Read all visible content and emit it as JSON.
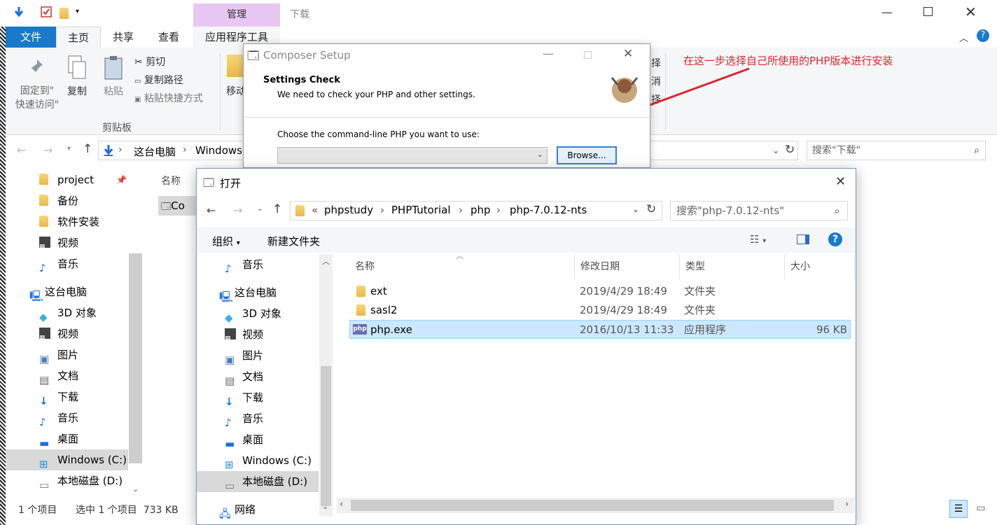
{
  "explorer": {
    "title_context": "管理",
    "title": "下载",
    "tabs": [
      "文件",
      "主页",
      "共享",
      "查看",
      "应用程序工具"
    ],
    "ribbon": {
      "pin_label": "固定到\"\n快速访问\"",
      "copy_label": "复制",
      "paste_label": "粘贴",
      "cut_label": "剪切",
      "copy_path_label": "复制路径",
      "paste_shortcut_label": "粘贴快捷方式",
      "move_label": "移动",
      "group_clipboard": "剪贴板",
      "partial_right": [
        "择",
        "消",
        "择"
      ]
    },
    "address": {
      "parts": [
        "这台电脑",
        "Windows"
      ]
    },
    "search_placeholder": "搜索\"下载\"",
    "nav": [
      "project",
      "备份",
      "软件安装",
      "视频",
      "音乐",
      "这台电脑",
      "3D 对象",
      "视频",
      "图片",
      "文档",
      "下载",
      "音乐",
      "桌面",
      "Windows (C:)",
      "本地磁盘 (D:)"
    ],
    "col_name": "名称",
    "file_partial": "Co",
    "status_count": "1 个项目",
    "status_selected": "选中 1 个项目  733 KB"
  },
  "annotation": "在这一步选择自己所使用的PHP版本进行安装",
  "composer": {
    "title": "Composer Setup",
    "heading": "Settings Check",
    "subheading": "We need to check your PHP and other settings.",
    "choose_label": "Choose the command-line PHP you want to use:",
    "combo_value": "",
    "browse_label": "Browse..."
  },
  "open_dialog": {
    "title": "打开",
    "path": [
      "«",
      "phpstudy",
      "PHPTutorial",
      "php",
      "php-7.0.12-nts"
    ],
    "search_placeholder": "搜索\"php-7.0.12-nts\"",
    "organize_label": "组织",
    "new_folder_label": "新建文件夹",
    "nav": [
      "音乐",
      "这台电脑",
      "3D 对象",
      "视频",
      "图片",
      "文档",
      "下载",
      "音乐",
      "桌面",
      "Windows (C:)",
      "本地磁盘 (D:)",
      "网络"
    ],
    "columns": [
      "名称",
      "修改日期",
      "类型",
      "大小"
    ],
    "files": [
      {
        "name": "ext",
        "date": "2019/4/29 18:49",
        "type": "文件夹",
        "size": ""
      },
      {
        "name": "sasl2",
        "date": "2019/4/29 18:49",
        "type": "文件夹",
        "size": ""
      },
      {
        "name": "php.exe",
        "date": "2016/10/13 11:33",
        "type": "应用程序",
        "size": "96 KB"
      }
    ]
  }
}
